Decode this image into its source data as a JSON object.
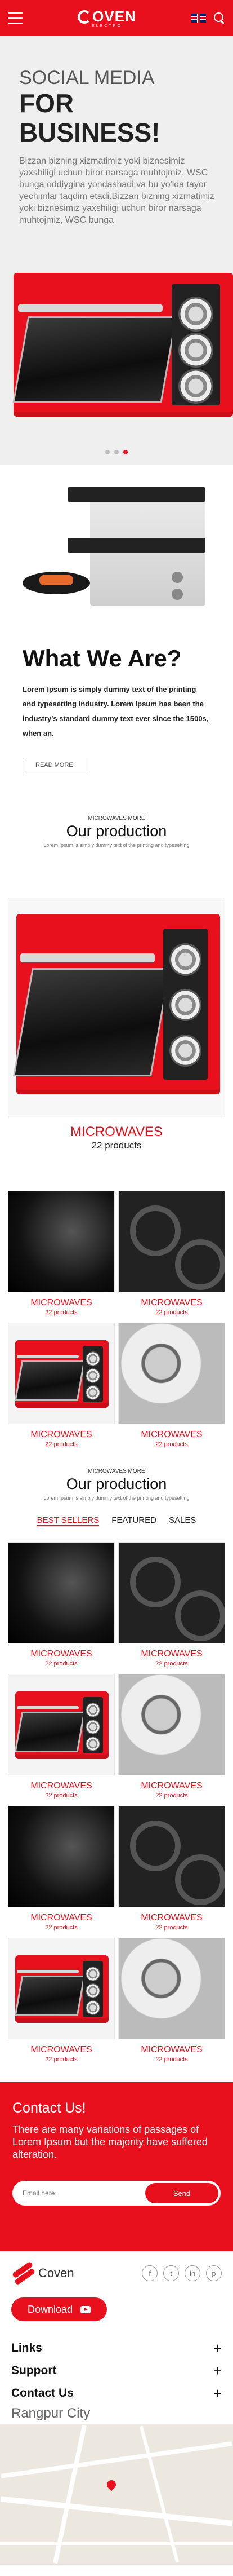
{
  "header": {
    "logo_text": "OVEN",
    "logo_sub": "ELECTRO",
    "brand_color": "#e8101c"
  },
  "hero": {
    "line1": "Social Media",
    "line2": "For Business!",
    "text": "Bizzan bizning xizmatimiz yoki biznesimiz yaxshiligi uchun biror narsaga muhtojmiz, WSC bunga oddiygina yondashadi va bu yo'lda tayor yechimlar taqdim etadi.Bizzan bizning xizmatimiz yoki biznesimiz yaxshiligi uchun biror narsaga muhtojmiz, WSC bunga"
  },
  "about": {
    "title": "What We Are?",
    "text": "Lorem Ipsum is simply dummy text of the printing and typesetting industry. Lorem Ipsum has been the industry's standard dummy text ever since the 1500s, when an.",
    "button": "READ MORE"
  },
  "production1": {
    "sup": "MICROWAVES MORE",
    "title": "Our production",
    "sub": "Lorem Ipsum is simply dummy text of the printing and typesetting",
    "featured": {
      "title": "MICROWAVES",
      "count": "22 products"
    },
    "items": [
      {
        "title": "MICROWAVES",
        "count": "22 products",
        "img": "black"
      },
      {
        "title": "MICROWAVES",
        "count": "22 products",
        "img": "stove"
      },
      {
        "title": "MICROWAVES",
        "count": "22 products",
        "img": "minioven"
      },
      {
        "title": "MICROWAVES",
        "count": "22 products",
        "img": "burner"
      }
    ]
  },
  "production2": {
    "sup": "MICROWAVES MORE",
    "title": "Our production",
    "sub": "Lorem Ipsum is simply dummy text of the printing and typesetting",
    "tabs": [
      "BEST SELLERS",
      "FEATURED",
      "SALES"
    ],
    "items": [
      {
        "title": "MICROWAVES",
        "count": "22 products",
        "img": "black"
      },
      {
        "title": "MICROWAVES",
        "count": "22 products",
        "img": "stove"
      },
      {
        "title": "MICROWAVES",
        "count": "22 products",
        "img": "minioven"
      },
      {
        "title": "MICROWAVES",
        "count": "22 products",
        "img": "burner"
      },
      {
        "title": "MICROWAVES",
        "count": "22 products",
        "img": "black"
      },
      {
        "title": "MICROWAVES",
        "count": "22 products",
        "img": "stove"
      },
      {
        "title": "MICROWAVES",
        "count": "22 products",
        "img": "minioven"
      },
      {
        "title": "MICROWAVES",
        "count": "22 products",
        "img": "burner"
      }
    ]
  },
  "contact": {
    "title": "Contact Us!",
    "text": "There are many variations of passages of Lorem Ipsum  but the majority have suffered alteration.",
    "email_placeholder": "Email here",
    "send_label": "Send"
  },
  "footer": {
    "logo_text": "Coven",
    "socials": [
      "f",
      "t",
      "in",
      "p"
    ],
    "download_label": "Download",
    "accordion": [
      "Links",
      "Support",
      "Contact Us"
    ],
    "city": "Rangpur City"
  }
}
